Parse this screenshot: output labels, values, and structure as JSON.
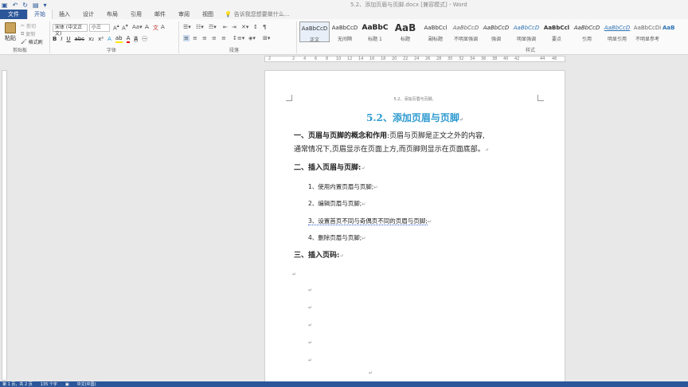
{
  "window": {
    "title": "5.2、添加页眉与页脚.docx [兼容模式] - Word"
  },
  "tabs": [
    "文件",
    "开始",
    "插入",
    "设计",
    "布局",
    "引用",
    "邮件",
    "审阅",
    "视图"
  ],
  "tell_me": "告诉我您想要做什么...",
  "clipboard": {
    "paste": "粘贴",
    "cut": "剪切",
    "copy": "复制",
    "format_painter": "格式刷",
    "label": "剪贴板"
  },
  "font": {
    "name": "宋体 (中文正文)",
    "size": "小三",
    "label": "字体",
    "bold": "B",
    "italic": "I",
    "underline": "U",
    "strike": "abc",
    "sub": "x₂",
    "sup": "x²"
  },
  "paragraph": {
    "label": "段落"
  },
  "styles": {
    "label": "样式",
    "items": [
      {
        "preview": "AaBbCcD",
        "name": "正文"
      },
      {
        "preview": "AaBbCcD",
        "name": "无间隔"
      },
      {
        "preview": "AaBbC",
        "name": "标题 1"
      },
      {
        "preview": "AaB",
        "name": "标题"
      },
      {
        "preview": "AaBbCcl",
        "name": "副标题"
      },
      {
        "preview": "AaBbCcD",
        "name": "不明显强调"
      },
      {
        "preview": "AaBbCcD",
        "name": "强调"
      },
      {
        "preview": "AaBbCcD",
        "name": "明显强调"
      },
      {
        "preview": "AaBbCcl",
        "name": "要点"
      },
      {
        "preview": "AaBbCcD",
        "name": "引用"
      },
      {
        "preview": "AaBbCcD",
        "name": "明显引用"
      },
      {
        "preview": "AaBbCcDi",
        "name": "不明显参考"
      },
      {
        "preview": "AaBl",
        "name": ""
      }
    ]
  },
  "ruler": [
    "2",
    "2",
    "4",
    "6",
    "8",
    "10",
    "12",
    "14",
    "16",
    "18",
    "20",
    "22",
    "24",
    "26",
    "28",
    "30",
    "32",
    "34",
    "36",
    "38",
    "40",
    "42",
    "44",
    "46"
  ],
  "document": {
    "header": "5.2、添加页眉与页脚。",
    "title": "5.2、添加页眉与页脚",
    "p1_bold": "一、页眉与页脚的概念和作用",
    "p1_text": ":页眉与页脚是正文之外的内容,",
    "p1_line2": "通常情况下,页眉显示在页面上方,而页脚则显示在页面底部。",
    "h2": "二、插入页眉与页脚:",
    "items": [
      "1、使用内置页眉与页脚;",
      "2、编辑页眉与页脚;",
      "3、设置首页不同与奇偶页不同的页眉与页脚;",
      "4、删除页眉与页脚;"
    ],
    "h3": "三、插入页码:",
    "para_mark": "↵"
  },
  "status": {
    "page": "第 1 页，共 2 页",
    "words": "135 个字",
    "lang": "中文(中国)"
  }
}
